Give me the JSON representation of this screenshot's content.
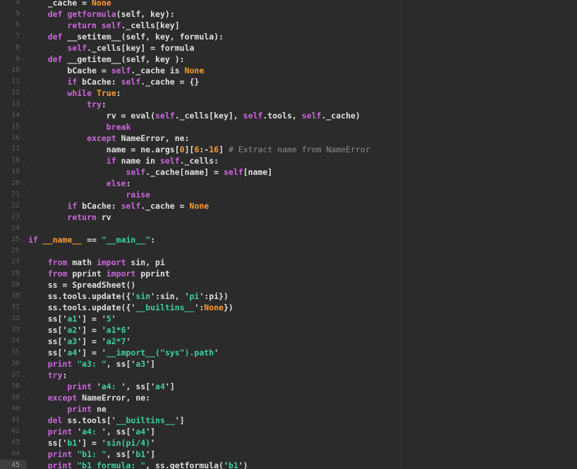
{
  "colors": {
    "background": "#2b2b2b",
    "gutter_text": "#5b5b5b",
    "default": "#e0e0e0",
    "keyword": "#cc66dd",
    "constant": "#ff9a2e",
    "string": "#3cd0a5",
    "comment": "#8a8a8a"
  },
  "current_line": "45",
  "lines": [
    {
      "n": "4",
      "fold": true,
      "t": [
        {
          "k": "tx",
          "v": "    _cache = "
        },
        {
          "k": "cn",
          "v": "None"
        }
      ]
    },
    {
      "n": "5",
      "fold": true,
      "t": [
        {
          "k": "tx",
          "v": "    "
        },
        {
          "k": "kw",
          "v": "def "
        },
        {
          "k": "fn",
          "v": "getformula"
        },
        {
          "k": "tx",
          "v": "(self, key):"
        }
      ]
    },
    {
      "n": "6",
      "fold": false,
      "t": [
        {
          "k": "tx",
          "v": "        "
        },
        {
          "k": "kw",
          "v": "return self"
        },
        {
          "k": "tx",
          "v": "._cells[key]"
        }
      ]
    },
    {
      "n": "7",
      "fold": true,
      "t": [
        {
          "k": "tx",
          "v": "    "
        },
        {
          "k": "kw",
          "v": "def "
        },
        {
          "k": "tx",
          "v": "__setitem__(self, key, formula):"
        }
      ]
    },
    {
      "n": "8",
      "fold": false,
      "t": [
        {
          "k": "tx",
          "v": "        "
        },
        {
          "k": "kw",
          "v": "self"
        },
        {
          "k": "tx",
          "v": "._cells[key] = formula"
        }
      ]
    },
    {
      "n": "9",
      "fold": true,
      "t": [
        {
          "k": "tx",
          "v": "    "
        },
        {
          "k": "kw",
          "v": "def "
        },
        {
          "k": "tx",
          "v": "__getitem__(self, key ):"
        }
      ]
    },
    {
      "n": "10",
      "fold": false,
      "t": [
        {
          "k": "tx",
          "v": "        bCache = "
        },
        {
          "k": "kw",
          "v": "self"
        },
        {
          "k": "tx",
          "v": "._cache is "
        },
        {
          "k": "cn",
          "v": "None"
        }
      ]
    },
    {
      "n": "11",
      "fold": false,
      "t": [
        {
          "k": "tx",
          "v": "        "
        },
        {
          "k": "kw",
          "v": "if "
        },
        {
          "k": "tx",
          "v": "bCache: "
        },
        {
          "k": "kw",
          "v": "self"
        },
        {
          "k": "tx",
          "v": "._cache = {}"
        }
      ]
    },
    {
      "n": "12",
      "fold": true,
      "t": [
        {
          "k": "tx",
          "v": "        "
        },
        {
          "k": "kw",
          "v": "while "
        },
        {
          "k": "cn",
          "v": "True"
        },
        {
          "k": "tx",
          "v": ":"
        }
      ]
    },
    {
      "n": "13",
      "fold": true,
      "t": [
        {
          "k": "tx",
          "v": "            "
        },
        {
          "k": "kw",
          "v": "try"
        },
        {
          "k": "tx",
          "v": ":"
        }
      ]
    },
    {
      "n": "14",
      "fold": false,
      "t": [
        {
          "k": "tx",
          "v": "                rv = eval("
        },
        {
          "k": "kw",
          "v": "self"
        },
        {
          "k": "tx",
          "v": "._cells[key], "
        },
        {
          "k": "kw",
          "v": "self"
        },
        {
          "k": "tx",
          "v": ".tools, "
        },
        {
          "k": "kw",
          "v": "self"
        },
        {
          "k": "tx",
          "v": "._cache)"
        }
      ]
    },
    {
      "n": "15",
      "fold": false,
      "t": [
        {
          "k": "tx",
          "v": "                "
        },
        {
          "k": "kw",
          "v": "break"
        }
      ]
    },
    {
      "n": "16",
      "fold": true,
      "t": [
        {
          "k": "tx",
          "v": "            "
        },
        {
          "k": "kw",
          "v": "except "
        },
        {
          "k": "tx",
          "v": "NameError, ne:"
        }
      ]
    },
    {
      "n": "17",
      "fold": false,
      "t": [
        {
          "k": "tx",
          "v": "                name = ne.args["
        },
        {
          "k": "nm",
          "v": "0"
        },
        {
          "k": "tx",
          "v": "]["
        },
        {
          "k": "nm",
          "v": "6"
        },
        {
          "k": "tx",
          "v": ":-"
        },
        {
          "k": "nm",
          "v": "16"
        },
        {
          "k": "tx",
          "v": "] "
        },
        {
          "k": "cm",
          "v": "# Extract name from NameError"
        }
      ]
    },
    {
      "n": "18",
      "fold": true,
      "t": [
        {
          "k": "tx",
          "v": "                "
        },
        {
          "k": "kw",
          "v": "if "
        },
        {
          "k": "tx",
          "v": "name in "
        },
        {
          "k": "kw",
          "v": "self"
        },
        {
          "k": "tx",
          "v": "._cells:"
        }
      ]
    },
    {
      "n": "19",
      "fold": false,
      "t": [
        {
          "k": "tx",
          "v": "                    "
        },
        {
          "k": "kw",
          "v": "self"
        },
        {
          "k": "tx",
          "v": "._cache[name] = "
        },
        {
          "k": "kw",
          "v": "self"
        },
        {
          "k": "tx",
          "v": "[name]"
        }
      ]
    },
    {
      "n": "20",
      "fold": true,
      "t": [
        {
          "k": "tx",
          "v": "                "
        },
        {
          "k": "kw",
          "v": "else"
        },
        {
          "k": "tx",
          "v": ":"
        }
      ]
    },
    {
      "n": "21",
      "fold": false,
      "t": [
        {
          "k": "tx",
          "v": "                    "
        },
        {
          "k": "kw",
          "v": "raise"
        }
      ]
    },
    {
      "n": "22",
      "fold": false,
      "t": [
        {
          "k": "tx",
          "v": "        "
        },
        {
          "k": "kw",
          "v": "if "
        },
        {
          "k": "tx",
          "v": "bCache: "
        },
        {
          "k": "kw",
          "v": "self"
        },
        {
          "k": "tx",
          "v": "._cache = "
        },
        {
          "k": "cn",
          "v": "None"
        }
      ]
    },
    {
      "n": "23",
      "fold": false,
      "t": [
        {
          "k": "tx",
          "v": "        "
        },
        {
          "k": "kw",
          "v": "return "
        },
        {
          "k": "tx",
          "v": "rv"
        }
      ]
    },
    {
      "n": "24",
      "fold": false,
      "t": []
    },
    {
      "n": "25",
      "fold": true,
      "t": [
        {
          "k": "kw",
          "v": "if "
        },
        {
          "k": "cn",
          "v": "__name__"
        },
        {
          "k": "tx",
          "v": " == "
        },
        {
          "k": "st",
          "v": "\"__main__\""
        },
        {
          "k": "tx",
          "v": ":"
        }
      ]
    },
    {
      "n": "26",
      "fold": false,
      "t": []
    },
    {
      "n": "27",
      "fold": false,
      "t": [
        {
          "k": "tx",
          "v": "    "
        },
        {
          "k": "kw",
          "v": "from "
        },
        {
          "k": "tx",
          "v": "math "
        },
        {
          "k": "kw",
          "v": "import "
        },
        {
          "k": "tx",
          "v": "sin, pi"
        }
      ]
    },
    {
      "n": "28",
      "fold": false,
      "t": [
        {
          "k": "tx",
          "v": "    "
        },
        {
          "k": "kw",
          "v": "from "
        },
        {
          "k": "tx",
          "v": "pprint "
        },
        {
          "k": "kw",
          "v": "import "
        },
        {
          "k": "tx",
          "v": "pprint"
        }
      ]
    },
    {
      "n": "29",
      "fold": false,
      "t": [
        {
          "k": "tx",
          "v": "    ss = SpreadSheet()"
        }
      ]
    },
    {
      "n": "30",
      "fold": false,
      "t": [
        {
          "k": "tx",
          "v": "    ss.tools.update({'"
        },
        {
          "k": "st",
          "v": "sin"
        },
        {
          "k": "tx",
          "v": "':sin, '"
        },
        {
          "k": "st",
          "v": "pi"
        },
        {
          "k": "tx",
          "v": "':pi})"
        }
      ]
    },
    {
      "n": "31",
      "fold": false,
      "t": [
        {
          "k": "tx",
          "v": "    ss.tools.update({'"
        },
        {
          "k": "st",
          "v": "__builtins__"
        },
        {
          "k": "tx",
          "v": "':"
        },
        {
          "k": "cn",
          "v": "None"
        },
        {
          "k": "tx",
          "v": "})"
        }
      ]
    },
    {
      "n": "32",
      "fold": false,
      "t": [
        {
          "k": "tx",
          "v": "    ss['"
        },
        {
          "k": "st",
          "v": "a1"
        },
        {
          "k": "tx",
          "v": "'] = '"
        },
        {
          "k": "st",
          "v": "5"
        },
        {
          "k": "tx",
          "v": "'"
        }
      ]
    },
    {
      "n": "33",
      "fold": false,
      "t": [
        {
          "k": "tx",
          "v": "    ss['"
        },
        {
          "k": "st",
          "v": "a2"
        },
        {
          "k": "tx",
          "v": "'] = '"
        },
        {
          "k": "st",
          "v": "a1*6"
        },
        {
          "k": "tx",
          "v": "'"
        }
      ]
    },
    {
      "n": "34",
      "fold": false,
      "t": [
        {
          "k": "tx",
          "v": "    ss['"
        },
        {
          "k": "st",
          "v": "a3"
        },
        {
          "k": "tx",
          "v": "'] = '"
        },
        {
          "k": "st",
          "v": "a2*7"
        },
        {
          "k": "tx",
          "v": "'"
        }
      ]
    },
    {
      "n": "35",
      "fold": false,
      "t": [
        {
          "k": "tx",
          "v": "    ss['"
        },
        {
          "k": "st",
          "v": "a4"
        },
        {
          "k": "tx",
          "v": "'] = '"
        },
        {
          "k": "st",
          "v": "__import__(\"sys\").path"
        },
        {
          "k": "tx",
          "v": "'"
        }
      ]
    },
    {
      "n": "36",
      "fold": false,
      "t": [
        {
          "k": "tx",
          "v": "    "
        },
        {
          "k": "kw",
          "v": "print "
        },
        {
          "k": "st",
          "v": "\"a3: \""
        },
        {
          "k": "tx",
          "v": ", ss['"
        },
        {
          "k": "st",
          "v": "a3"
        },
        {
          "k": "tx",
          "v": "']"
        }
      ]
    },
    {
      "n": "37",
      "fold": true,
      "t": [
        {
          "k": "tx",
          "v": "    "
        },
        {
          "k": "kw",
          "v": "try"
        },
        {
          "k": "tx",
          "v": ":"
        }
      ]
    },
    {
      "n": "38",
      "fold": false,
      "t": [
        {
          "k": "tx",
          "v": "        "
        },
        {
          "k": "kw",
          "v": "print "
        },
        {
          "k": "tx",
          "v": "'"
        },
        {
          "k": "st",
          "v": "a4: "
        },
        {
          "k": "tx",
          "v": "', ss['"
        },
        {
          "k": "st",
          "v": "a4"
        },
        {
          "k": "tx",
          "v": "']"
        }
      ]
    },
    {
      "n": "39",
      "fold": true,
      "t": [
        {
          "k": "tx",
          "v": "    "
        },
        {
          "k": "kw",
          "v": "except "
        },
        {
          "k": "tx",
          "v": "NameError, ne:"
        }
      ]
    },
    {
      "n": "40",
      "fold": false,
      "t": [
        {
          "k": "tx",
          "v": "        "
        },
        {
          "k": "kw",
          "v": "print "
        },
        {
          "k": "tx",
          "v": "ne"
        }
      ]
    },
    {
      "n": "41",
      "fold": false,
      "t": [
        {
          "k": "tx",
          "v": "    "
        },
        {
          "k": "kw",
          "v": "del "
        },
        {
          "k": "tx",
          "v": "ss.tools['"
        },
        {
          "k": "st",
          "v": "__builtins__"
        },
        {
          "k": "tx",
          "v": "']"
        }
      ]
    },
    {
      "n": "42",
      "fold": false,
      "t": [
        {
          "k": "tx",
          "v": "    "
        },
        {
          "k": "kw",
          "v": "print "
        },
        {
          "k": "tx",
          "v": "'"
        },
        {
          "k": "st",
          "v": "a4: "
        },
        {
          "k": "tx",
          "v": "', ss['"
        },
        {
          "k": "st",
          "v": "a4"
        },
        {
          "k": "tx",
          "v": "']"
        }
      ]
    },
    {
      "n": "43",
      "fold": false,
      "t": [
        {
          "k": "tx",
          "v": "    ss['"
        },
        {
          "k": "st",
          "v": "b1"
        },
        {
          "k": "tx",
          "v": "'] = '"
        },
        {
          "k": "st",
          "v": "sin(pi/4)"
        },
        {
          "k": "tx",
          "v": "'"
        }
      ]
    },
    {
      "n": "44",
      "fold": false,
      "t": [
        {
          "k": "tx",
          "v": "    "
        },
        {
          "k": "kw",
          "v": "print "
        },
        {
          "k": "st",
          "v": "\"b1: \""
        },
        {
          "k": "tx",
          "v": ", ss['"
        },
        {
          "k": "st",
          "v": "b1"
        },
        {
          "k": "tx",
          "v": "']"
        }
      ]
    },
    {
      "n": "45",
      "fold": false,
      "t": [
        {
          "k": "tx",
          "v": "    "
        },
        {
          "k": "kw",
          "v": "print "
        },
        {
          "k": "st",
          "v": "\"b1 formula: \""
        },
        {
          "k": "tx",
          "v": ", ss.getformula('"
        },
        {
          "k": "st",
          "v": "b1"
        },
        {
          "k": "tx",
          "v": "')"
        }
      ]
    }
  ]
}
